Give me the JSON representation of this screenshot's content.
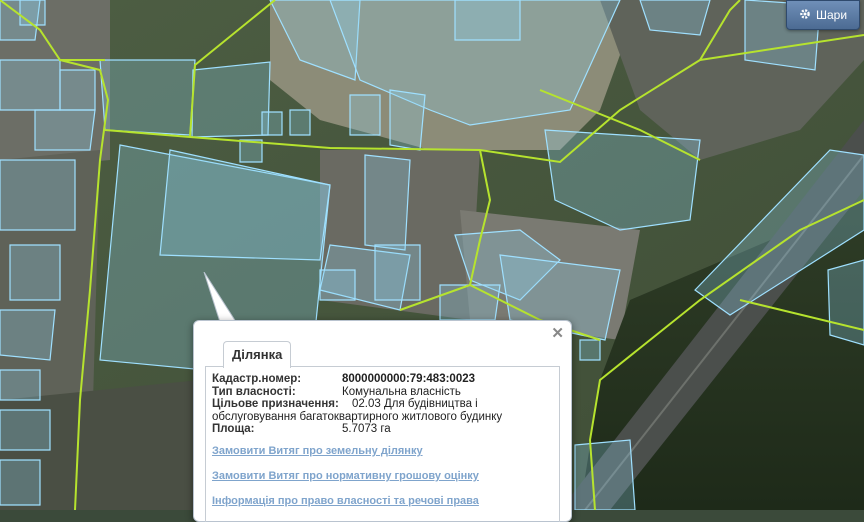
{
  "layers_button": {
    "label": "Шари",
    "icon": "gear-icon"
  },
  "popup": {
    "tab_label": "Ділянка",
    "close_icon": "close-icon",
    "fields": {
      "cadastral_label": "Кадастр.номер:",
      "cadastral_value": "8000000000:79:483:0023",
      "ownership_label": "Тип власності:",
      "ownership_value": "Комунальна власність",
      "purpose_label": "Цільове призначення:",
      "purpose_value": "02.03 Для будівництва і",
      "purpose_value_cont": "обслуговування багатоквартирного житлового будинку",
      "area_label": "Площа:",
      "area_value": "5.7073 га"
    },
    "links": [
      "Замовити Витяг про земельну ділянку",
      "Замовити Витяг про нормативну грошову оцінку",
      "Інформація про право власності та речові права"
    ]
  },
  "colors": {
    "parcel_fill": "#8fd3f0",
    "parcel_stroke": "#9fe0ff",
    "boundary": "#b6e32e",
    "link": "#7fa4cc",
    "button": "#5a7aa3"
  }
}
